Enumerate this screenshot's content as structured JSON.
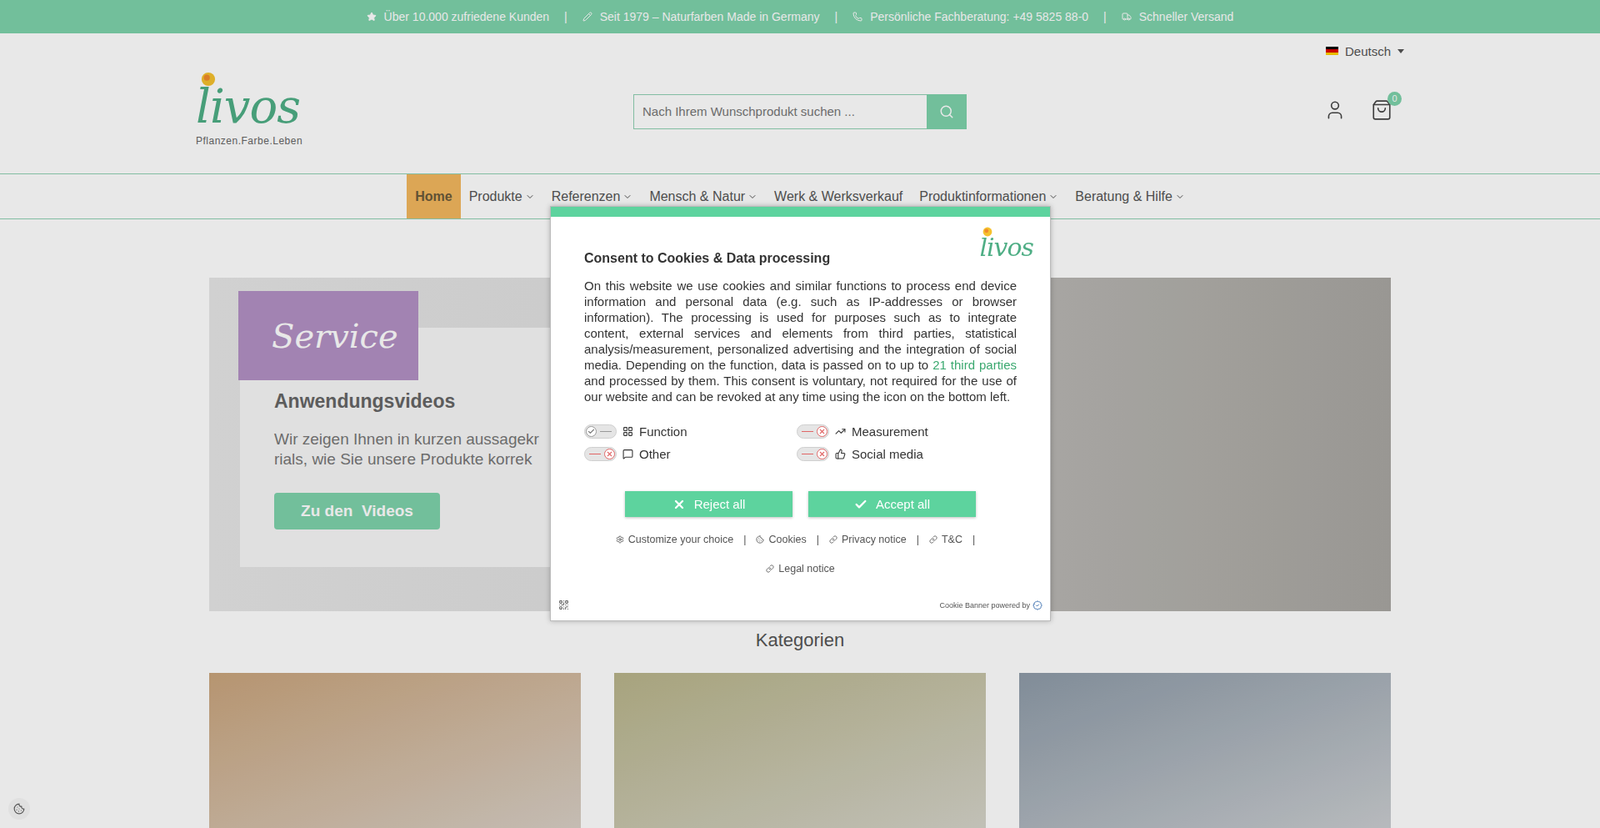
{
  "top_bar": {
    "items": [
      "Über 10.000 zufriedene Kunden",
      "Seit 1979 – Naturfarben Made in Germany",
      "Persönliche Fachberatung: +49 5825 88-0",
      "Schneller Versand"
    ],
    "separator": "|"
  },
  "language": "Deutsch",
  "logo": {
    "name": "livos",
    "tagline": "Pflanzen.Farbe.Leben"
  },
  "search": {
    "placeholder": "Nach Ihrem Wunschprodukt suchen ..."
  },
  "cart": {
    "count": "0"
  },
  "nav": [
    {
      "label": "Home",
      "selected": true,
      "dropdown": false
    },
    {
      "label": "Produkte",
      "selected": false,
      "dropdown": true
    },
    {
      "label": "Referenzen",
      "selected": false,
      "dropdown": true
    },
    {
      "label": "Mensch & Natur",
      "selected": false,
      "dropdown": true
    },
    {
      "label": "Werk & Werksverkauf",
      "selected": false,
      "dropdown": false
    },
    {
      "label": "Produktinformationen",
      "selected": false,
      "dropdown": true
    },
    {
      "label": "Beratung & Hilfe",
      "selected": false,
      "dropdown": true
    }
  ],
  "banner": {
    "tag": "Service",
    "title": "Anwendungsvideos",
    "lines": [
      "Wir zeigen Ihnen in kurzen aussagekr",
      "rials, wie Sie unsere Produkte korrek"
    ],
    "button": "Zu den  Videos"
  },
  "categories": {
    "title": "Kategorien",
    "cards": [
      {
        "color": "#c9a47c"
      },
      {
        "color": "#b8b48a"
      },
      {
        "color": "#8e9ba8"
      }
    ]
  },
  "consent": {
    "title": "Consent to Cookies & Data processing",
    "text_before": "On this website we use cookies and similar functions to process end device information and personal data (e.g. such as IP-addresses or browser information). The processing is used for purposes such as to integrate content, external services and elements from third parties, statistical analysis/measurement, personalized advertising and the integration of social media. Depending on the function, data is passed on to up to ",
    "link": "21 third parties",
    "text_after": " and processed by them. This consent is voluntary, not required for the use of our website and can be revoked at any time using the icon on the bottom left.",
    "toggles": [
      {
        "label": "Function",
        "on": true,
        "locked": true
      },
      {
        "label": "Measurement",
        "on": false,
        "locked": false
      },
      {
        "label": "Other",
        "on": false,
        "locked": false
      },
      {
        "label": "Social media",
        "on": false,
        "locked": false
      }
    ],
    "buttons": [
      "Reject all",
      "Accept all"
    ],
    "links": [
      "Customize your choice",
      "Cookies",
      "Privacy notice",
      "T&C",
      "Legal notice"
    ],
    "separator": "|",
    "powered_by": "Cookie Banner powered by"
  }
}
